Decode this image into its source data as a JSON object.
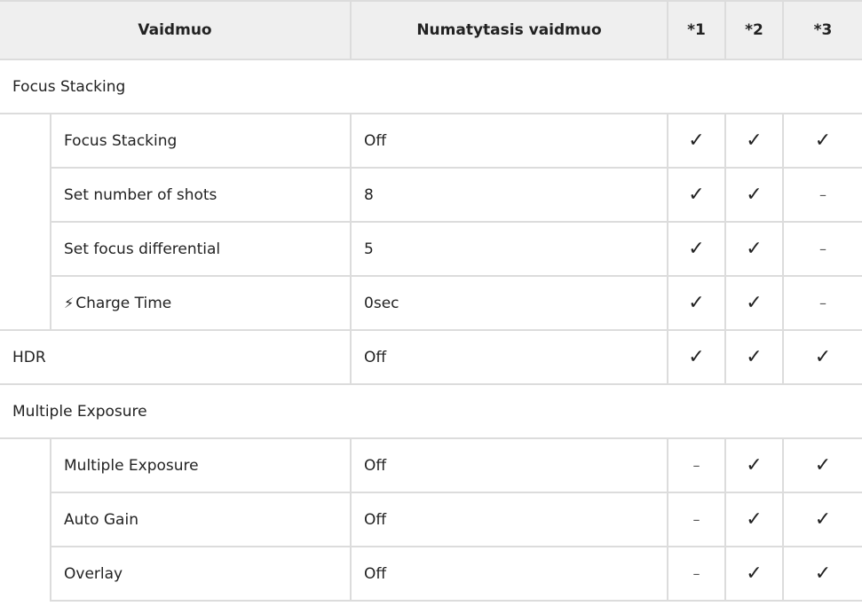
{
  "header": {
    "option": "Vaidmuo",
    "default": "Numatytasis vaidmuo",
    "c1": "*1",
    "c2": "*2",
    "c3": "*3"
  },
  "groups": {
    "focus_stacking": {
      "label": "Focus Stacking"
    },
    "multiple_exposure": {
      "label": "Multiple Exposure"
    }
  },
  "rows": [
    {
      "name": "Focus Stacking",
      "value": "Off",
      "c1": "✓",
      "c2": "✓",
      "c3": "✓"
    },
    {
      "name": "Set number of shots",
      "value": "8",
      "c1": "✓",
      "c2": "✓",
      "c3": "–"
    },
    {
      "name": "Set focus differential",
      "value": "5",
      "c1": "✓",
      "c2": "✓",
      "c3": "–"
    },
    {
      "name": "Charge Time",
      "icon": "flash-icon",
      "value": "0sec",
      "c1": "✓",
      "c2": "✓",
      "c3": "–"
    },
    {
      "name": "HDR",
      "value": "Off",
      "c1": "✓",
      "c2": "✓",
      "c3": "✓"
    },
    {
      "name": "Multiple Exposure",
      "value": "Off",
      "c1": "–",
      "c2": "✓",
      "c3": "✓"
    },
    {
      "name": "Auto Gain",
      "value": "Off",
      "c1": "–",
      "c2": "✓",
      "c3": "✓"
    },
    {
      "name": "Overlay",
      "value": "Off",
      "c1": "–",
      "c2": "✓",
      "c3": "✓"
    }
  ]
}
